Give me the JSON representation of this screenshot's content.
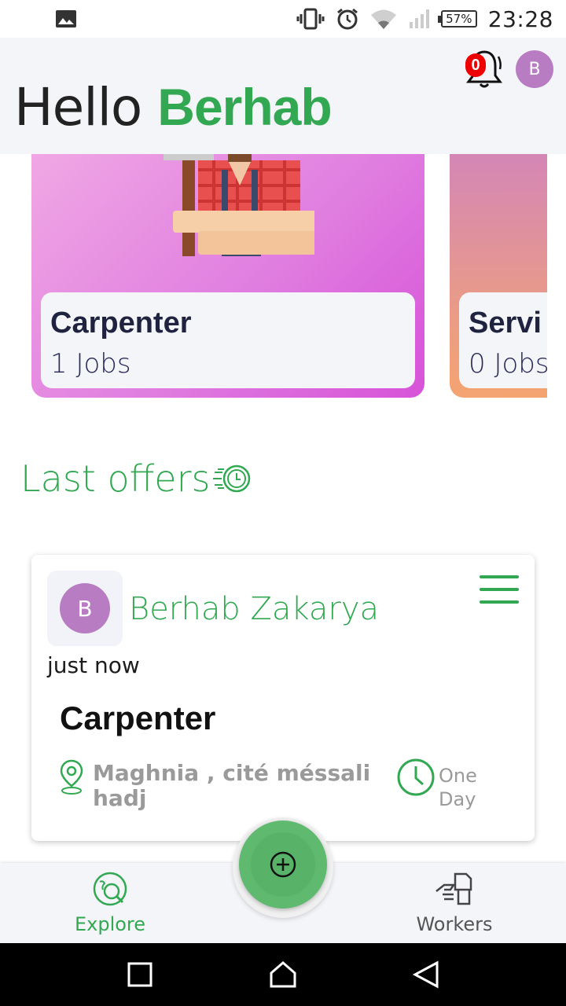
{
  "status_bar": {
    "battery": "57%",
    "time": "23:28",
    "icons": [
      "gallery-icon",
      "vibrate-icon",
      "alarm-icon",
      "wifi-icon",
      "signal-icon",
      "battery-icon"
    ]
  },
  "header": {
    "greeting": "Hello",
    "user_name": "Berhab",
    "notification_count": "0",
    "avatar_initial": "B"
  },
  "categories": [
    {
      "name": "Carpenter",
      "jobs": "1 Jobs"
    },
    {
      "name": "Servi",
      "jobs": "0 Jobs"
    }
  ],
  "last_offers": {
    "title": "Last offers"
  },
  "offer": {
    "avatar_initial": "B",
    "user": "Berhab Zakarya",
    "time": "just now",
    "title": "Carpenter",
    "location": "Maghnia , cité méssali hadj",
    "duration": "One Day"
  },
  "bottom_nav": {
    "explore": "Explore",
    "workers": "Workers"
  },
  "colors": {
    "accent_green": "#33a852",
    "avatar_purple": "#b77cc2",
    "badge_red": "#e00000"
  }
}
